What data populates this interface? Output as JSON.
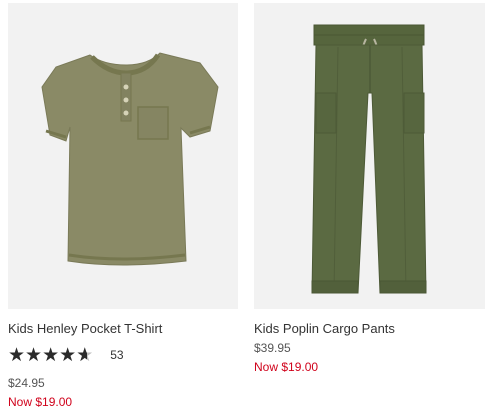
{
  "products": [
    {
      "name": "Kids Henley Pocket T-Shirt",
      "rating": 4.5,
      "review_count": "53",
      "price": "$24.95",
      "sale_price": "Now $19.00",
      "colors": {
        "garment": "#8a8a66",
        "background": "#f2f2f2"
      }
    },
    {
      "name": "Kids Poplin Cargo Pants",
      "price": "$39.95",
      "sale_price": "Now $19.00",
      "colors": {
        "garment": "#5b6a42",
        "background": "#f2f2f2"
      }
    }
  ],
  "colors": {
    "sale": "#d0021b",
    "text": "#333333",
    "star": "#2b2b2b"
  }
}
